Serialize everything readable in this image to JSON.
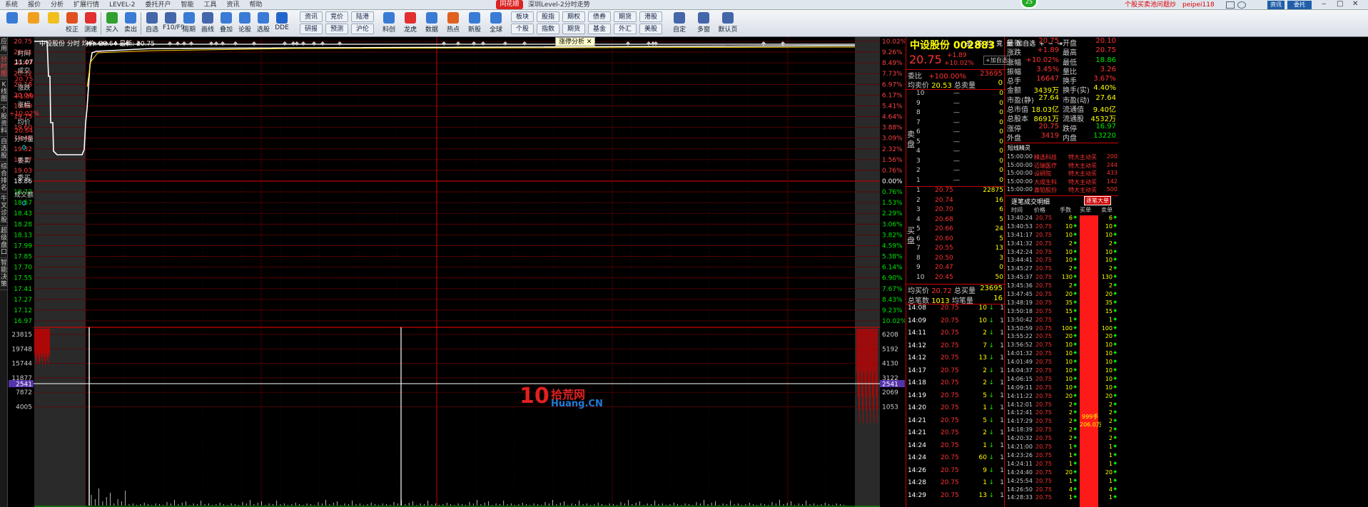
{
  "window": {
    "menus": [
      "系统",
      "报价",
      "分析",
      "扩展行情",
      "LEVEL-2",
      "委托开户",
      "智能",
      "工具",
      "资讯",
      "帮助"
    ],
    "title": "深圳Level-2分时走势",
    "user_link": "个股买卖池问题炒",
    "user": "peipei118",
    "btn1": "资讯",
    "btn2": "委托"
  },
  "toolbar": {
    "main": [
      {
        "label": "",
        "icon": "app-icon"
      },
      {
        "label": "",
        "icon": "back-icon"
      },
      {
        "label": "",
        "icon": "up-down-icon"
      },
      {
        "label": "校正",
        "icon": "calibrate-icon"
      },
      {
        "label": "测速",
        "icon": "speed-icon"
      },
      {
        "label": "买入",
        "icon": "buy-icon"
      },
      {
        "label": "卖出",
        "icon": "sell-icon"
      },
      {
        "label": "自选",
        "icon": "watchlist-icon"
      },
      {
        "label": "F10/F9",
        "icon": "f10-icon"
      },
      {
        "label": "周期",
        "icon": "period-icon"
      },
      {
        "label": "画线",
        "icon": "draw-icon"
      },
      {
        "label": "叠加",
        "icon": "overlay-icon"
      },
      {
        "label": "论股",
        "icon": "discuss-icon"
      },
      {
        "label": "选股",
        "icon": "select-icon"
      },
      {
        "label": "DDE",
        "icon": "dde-icon"
      }
    ],
    "grid": [
      [
        "资讯",
        "竞价",
        "陆港"
      ],
      [
        "研报",
        "预测",
        "沪伦"
      ]
    ],
    "main2": [
      {
        "label": "料创",
        "icon": "kcb-icon"
      },
      {
        "label": "龙虎",
        "icon": "dragon-icon"
      },
      {
        "label": "数据",
        "icon": "data-icon"
      },
      {
        "label": "热点",
        "icon": "hot-icon"
      },
      {
        "label": "新股",
        "icon": "ipo-icon"
      },
      {
        "label": "全球",
        "icon": "globe-icon"
      }
    ],
    "grid2": [
      [
        "板块",
        "股指",
        "期权",
        "债券",
        "期货",
        "港股"
      ],
      [
        "个股",
        "指数",
        "期货",
        "基金",
        "外汇",
        "美股"
      ]
    ],
    "main3": [
      {
        "label": "自定",
        "icon": "custom-icon"
      },
      {
        "label": "多窗",
        "icon": "multiwin-icon"
      },
      {
        "label": "默认页",
        "icon": "home-icon"
      }
    ]
  },
  "left_strip": [
    "应用",
    "分时图",
    "K线图",
    "个股资料",
    "自选股",
    "综合排名",
    "牛叉诊股",
    "超级盘口",
    "智能决策"
  ],
  "info_panel": {
    "time_label": "时间",
    "time": "11:07",
    "price_label": "成交",
    "price": "20.75",
    "chg_label": "涨跌",
    "chg": "+1.89",
    "pct_label": "涨幅",
    "pct": "+10.02%",
    "avg_label": "均价",
    "avg": "20.64",
    "vol_label": "分时量",
    "vol": "0",
    "sell1_label": "委卖",
    "sell2_label": "委买",
    "amt_label": "成交额",
    "amt": "0"
  },
  "chart": {
    "header": "中设股份 分时 均价: 20.64 最新: 20.75",
    "popup": "涨停分析",
    "tools": [
      "委",
      "筹",
      "均",
      "竞",
      "量",
      "加自选",
      "+",
      "−",
      "⇥"
    ],
    "price_ticks": [
      "20.75",
      "20.61",
      "20.47",
      "20.32",
      "20.18",
      "20.04",
      "19.89",
      "19.75",
      "19.60",
      "19.46",
      "19.32",
      "19.17",
      "19.03",
      "18.86",
      "18.72",
      "18.57",
      "18.43",
      "18.28",
      "18.13",
      "17.99",
      "17.85",
      "17.70",
      "17.55",
      "17.41",
      "17.27",
      "17.12",
      "16.97"
    ],
    "pct_ticks": [
      "10.02%",
      "9.26%",
      "8.49%",
      "7.73%",
      "6.97%",
      "6.17%",
      "5.41%",
      "4.64%",
      "3.88%",
      "3.09%",
      "2.32%",
      "1.56%",
      "0.76%",
      "0.00%",
      "0.76%",
      "1.53%",
      "2.29%",
      "3.06%",
      "3.82%",
      "4.59%",
      "5.38%",
      "6.14%",
      "6.90%",
      "7.67%",
      "8.43%",
      "9.23%",
      "10.02%"
    ],
    "vol_ticks": [
      "23815",
      "19748",
      "15744",
      "11877",
      "7872",
      "4005"
    ],
    "vol_ticks_right": [
      "6208",
      "5192",
      "4130",
      "3122",
      "2069",
      "1053"
    ],
    "cross_label": "2541"
  },
  "quote": {
    "name": "中设股份",
    "code": "002883",
    "price": "20.75",
    "chg": "+1.89",
    "pct": "+10.02%",
    "add_btn": "+加自选",
    "wb_label": "委比",
    "wb": "+100.00%",
    "wc": "23695",
    "avg_sell_label": "均卖价",
    "avg_sell": "20.53",
    "total_sell_label": "总卖量",
    "total_sell": "0",
    "sell_label": "卖盘",
    "buy_label": "买盘",
    "asks": [
      [
        "10",
        "—",
        "0"
      ],
      [
        "9",
        "—",
        "0"
      ],
      [
        "8",
        "—",
        "0"
      ],
      [
        "7",
        "—",
        "0"
      ],
      [
        "6",
        "—",
        "0"
      ],
      [
        "5",
        "—",
        "0"
      ],
      [
        "4",
        "—",
        "0"
      ],
      [
        "3",
        "—",
        "0"
      ],
      [
        "2",
        "—",
        "0"
      ],
      [
        "1",
        "—",
        "0"
      ]
    ],
    "bids": [
      [
        "1",
        "20.75",
        "22875"
      ],
      [
        "2",
        "20.74",
        "16"
      ],
      [
        "3",
        "20.70",
        "6"
      ],
      [
        "4",
        "20.68",
        "5"
      ],
      [
        "5",
        "20.66",
        "24"
      ],
      [
        "6",
        "20.60",
        "5"
      ],
      [
        "7",
        "20.55",
        "13"
      ],
      [
        "8",
        "20.50",
        "3"
      ],
      [
        "9",
        "20.47",
        "0"
      ],
      [
        "10",
        "20.45",
        "50"
      ]
    ],
    "avg_buy_label": "均买价",
    "avg_buy": "20.72",
    "total_buy_label": "总买量",
    "total_buy": "23695",
    "trades_label": "总笔数",
    "trades": "1013",
    "avg_vol_label": "均笔量",
    "avg_vol": "16",
    "ticks": [
      [
        "14:08",
        "20.75",
        "10",
        "↓",
        "1"
      ],
      [
        "14:09",
        "20.75",
        "10",
        "↓",
        "1"
      ],
      [
        "14:11",
        "20.75",
        "2",
        "↓",
        "1"
      ],
      [
        "14:12",
        "20.75",
        "7",
        "↓",
        "1"
      ],
      [
        "14:12",
        "20.75",
        "13",
        "↓",
        "1"
      ],
      [
        "14:17",
        "20.75",
        "2",
        "↓",
        "1"
      ],
      [
        "14:18",
        "20.75",
        "2",
        "↓",
        "1"
      ],
      [
        "14:19",
        "20.75",
        "5",
        "↓",
        "1"
      ],
      [
        "14:20",
        "20.75",
        "1",
        "↓",
        "1"
      ],
      [
        "14:21",
        "20.75",
        "5",
        "↓",
        "1"
      ],
      [
        "14:21",
        "20.75",
        "2",
        "↓",
        "1"
      ],
      [
        "14:24",
        "20.75",
        "1",
        "↓",
        "1"
      ],
      [
        "14:24",
        "20.75",
        "60",
        "↓",
        "1"
      ],
      [
        "14:26",
        "20.75",
        "9",
        "↓",
        "1"
      ],
      [
        "14:28",
        "20.75",
        "1",
        "↓",
        "1"
      ],
      [
        "14:29",
        "20.75",
        "13",
        "↓",
        "1"
      ]
    ]
  },
  "stats": [
    [
      "最新",
      "20.75",
      "开盘",
      "20.10"
    ],
    [
      "涨跌",
      "+1.89",
      "最高",
      "20.75"
    ],
    [
      "涨幅",
      "+10.02%",
      "最低",
      "18.86"
    ],
    [
      "振幅",
      "3.45%",
      "量比",
      "3.26"
    ],
    [
      "总手",
      "16647",
      "换手",
      "3.67%"
    ],
    [
      "金额",
      "3439万",
      "换手(实)",
      "4.40%"
    ],
    [
      "市盈(静)",
      "27.64",
      "市盈(动)",
      "27.64"
    ],
    [
      "总市值",
      "18.03亿",
      "流通值",
      "9.40亿"
    ],
    [
      "总股本",
      "8691万",
      "流通股",
      "4532万"
    ],
    [
      "涨停",
      "20.75",
      "跌停",
      "16.97"
    ],
    [
      "外盘",
      "3419",
      "内盘",
      "13220"
    ]
  ],
  "alerts": {
    "title": "短线精灵",
    "rows": [
      [
        "15:00:00",
        "精选科技",
        "特大主动买",
        "200"
      ],
      [
        "15:00:00",
        "迈瑞医疗",
        "特大主动买",
        "244"
      ],
      [
        "15:00:00",
        "设研院",
        "特大主动买",
        "433"
      ],
      [
        "15:00:00",
        "大成生科",
        "特大主动买",
        "142"
      ],
      [
        "15:00:00",
        "鑫铂股份",
        "特大主动买",
        "500"
      ]
    ]
  },
  "ticklist": {
    "title": "逐笔成交明细",
    "btn": "逐笔大单",
    "cols": [
      "时间",
      "价格",
      "手数",
      "买单",
      "卖单"
    ],
    "rows": [
      [
        "13:40:24",
        "20.75",
        "6"
      ],
      [
        "13:40:53",
        "20.75",
        "10"
      ],
      [
        "13:41:17",
        "20.75",
        "10"
      ],
      [
        "13:41:32",
        "20.75",
        "2"
      ],
      [
        "13:42:24",
        "20.75",
        "10"
      ],
      [
        "13:44:41",
        "20.75",
        "10"
      ],
      [
        "13:45:27",
        "20.75",
        "2"
      ],
      [
        "13:45:37",
        "20.75",
        "130"
      ],
      [
        "13:45:36",
        "20.75",
        "2"
      ],
      [
        "13:47:45",
        "20.75",
        "20"
      ],
      [
        "13:48:19",
        "20.75",
        "35"
      ],
      [
        "13:50:18",
        "20.75",
        "15"
      ],
      [
        "13:50:42",
        "20.75",
        "1"
      ],
      [
        "13:50:59",
        "20.75",
        "100"
      ],
      [
        "13:55:22",
        "20.75",
        "20"
      ],
      [
        "13:56:52",
        "20.75",
        "10"
      ],
      [
        "14:01:32",
        "20.75",
        "10"
      ],
      [
        "14:01:49",
        "20.75",
        "10"
      ],
      [
        "14:04:37",
        "20.75",
        "10"
      ],
      [
        "14:06:15",
        "20.75",
        "10"
      ],
      [
        "14:09:11",
        "20.75",
        "10"
      ],
      [
        "14:11:22",
        "20.75",
        "20"
      ],
      [
        "14:12:01",
        "20.75",
        "2"
      ],
      [
        "14:12:41",
        "20.75",
        "2"
      ],
      [
        "14:17:29",
        "20.75",
        "2"
      ],
      [
        "14:18:39",
        "20.75",
        "2"
      ],
      [
        "14:20:32",
        "20.75",
        "2"
      ],
      [
        "14:21:00",
        "20.75",
        "1"
      ],
      [
        "14:23:26",
        "20.75",
        "1"
      ],
      [
        "14:24:11",
        "20.75",
        "1"
      ],
      [
        "14:24:40",
        "20.75",
        "20"
      ],
      [
        "14:25:54",
        "20.75",
        "1"
      ],
      [
        "14:26:50",
        "20.75",
        "4"
      ],
      [
        "14:28:33",
        "20.75",
        "1"
      ]
    ],
    "bar_label1": "999手",
    "bar_label2": "206.0万"
  },
  "watermark": {
    "num": "10",
    "cn": "拾荒网",
    "en": "Huang.CN"
  }
}
